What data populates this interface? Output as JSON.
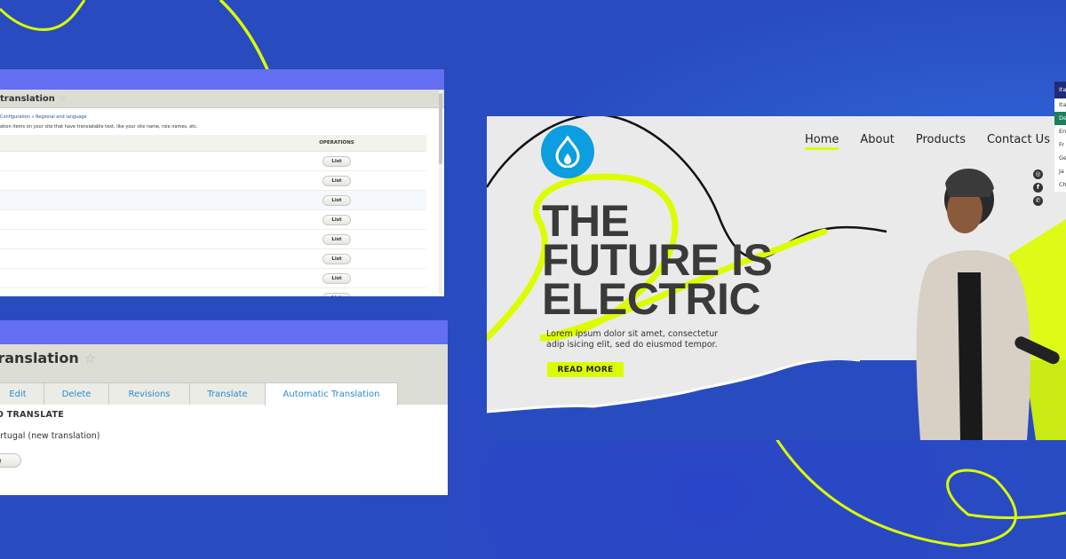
{
  "background": {
    "color": "#284cc0",
    "accent": "#dcfd00"
  },
  "config_panel": {
    "title": "translation",
    "breadcrumb": "Configuration » Regional and language",
    "description": "ation items on your site that have translatable text, like your site name, role names, etc.",
    "columns": [
      "",
      "OPERATIONS"
    ],
    "rows": [
      {
        "operation": "List"
      },
      {
        "operation": "List"
      },
      {
        "operation": "List"
      },
      {
        "operation": "List"
      },
      {
        "operation": "List"
      },
      {
        "operation": "List"
      },
      {
        "operation": "List"
      },
      {
        "operation": "List"
      }
    ]
  },
  "node_panel": {
    "title": "tic Translation",
    "tabs": [
      {
        "label": "Edit",
        "active": false
      },
      {
        "label": "Delete",
        "active": false
      },
      {
        "label": "Revisions",
        "active": false
      },
      {
        "label": "Translate",
        "active": false
      },
      {
        "label": "Automatic Translation",
        "active": true
      }
    ],
    "section_heading": "TO TRANSLATE",
    "item": "Portugal (new translation)",
    "button": "e"
  },
  "hero": {
    "nav": [
      {
        "label": "Home",
        "active": true
      },
      {
        "label": "About",
        "active": false
      },
      {
        "label": "Products",
        "active": false
      },
      {
        "label": "Contact Us",
        "active": false
      }
    ],
    "headline": [
      "THE",
      "FUTURE IS",
      "ELECTRIC"
    ],
    "subtext": [
      "Lorem ipsum dolor sit amet, consectetur",
      "adip isicing elit, sed do eiusmod tempor."
    ],
    "cta": "READ MORE",
    "socials": [
      "instagram-icon",
      "facebook-icon",
      "whatsapp-icon"
    ]
  },
  "language_menu": {
    "header": "Ita",
    "options": [
      {
        "label": "Ita",
        "selected": false
      },
      {
        "label": "De",
        "selected": true
      },
      {
        "label": "En",
        "selected": false
      },
      {
        "label": "Fr",
        "selected": false
      },
      {
        "label": "Ge",
        "selected": false
      },
      {
        "label": "Ja",
        "selected": false
      },
      {
        "label": "Ch",
        "selected": false
      }
    ]
  }
}
